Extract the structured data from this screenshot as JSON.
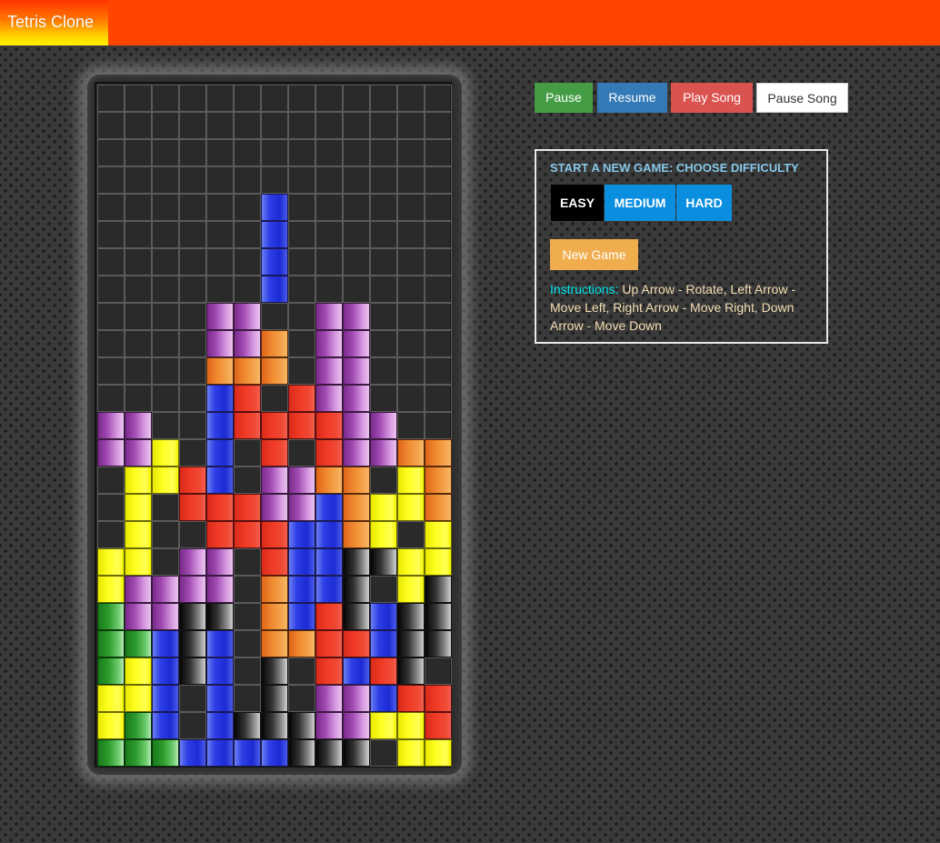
{
  "app": {
    "title": "Tetris Clone"
  },
  "controls": {
    "pause": "Pause",
    "resume": "Resume",
    "play_song": "Play Song",
    "pause_song": "Pause Song"
  },
  "new_game_panel": {
    "title": "START A NEW GAME: CHOOSE DIFFICULTY",
    "difficulties": [
      "EASY",
      "MEDIUM",
      "HARD"
    ],
    "selected_difficulty": "EASY",
    "new_game_label": "New Game",
    "instructions_label": "Instructions:",
    "instructions_text": " Up Arrow - Rotate, Left Arrow - Move Left, Right Arrow - Move Right, Down Arrow - Move Down"
  },
  "board": {
    "columns": 13,
    "rows": 25,
    "legend": {
      ".": "empty",
      "B": "blue",
      "P": "purple",
      "O": "orange",
      "R": "red",
      "Y": "yellow",
      "G": "green",
      "K": "black"
    },
    "grid": [
      ".............",
      ".............",
      ".............",
      ".............",
      "......B......",
      "......B......",
      "......B......",
      "......B......",
      "....PP..PP...",
      "....PPO.PP...",
      "....OOO.PP...",
      "....BR.RPP...",
      "PP..BRRRRPP..",
      "PPY.B.R.RPPOO",
      ".YYRB.PPOO.YO",
      ".Y.RRRPPBOYYO",
      ".Y..RRRBBOY.Y",
      "YY.PP.RBBKKYY",
      "YPPPP.OBBK.YK",
      "GPPKK.OBRKBKK",
      "GGBKB.OORRBKK",
      "GYBKB.K.RBRK.",
      "YYB.B.K.PPBRR",
      "YGB.BKKKPPYYR",
      "GGGBBBBKKK.YY"
    ]
  }
}
